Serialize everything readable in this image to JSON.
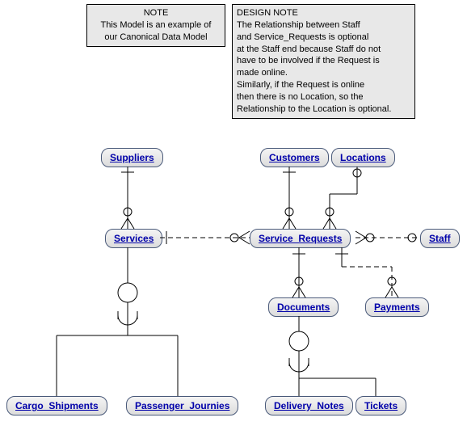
{
  "notes": {
    "note1": {
      "title": "NOTE",
      "line1": "This Model is an example of",
      "line2": "our Canonical Data Model"
    },
    "note2": {
      "title": "DESIGN NOTE",
      "l1": "The Relationship between Staff",
      "l2": "and Service_Requests is optional",
      "l3": "at the Staff end because Staff do not",
      "l4": "have to be involved if the Request is",
      "l5": "made online.",
      "l6": "Similarly, if the Request is online",
      "l7": "then there is no Location, so the",
      "l8": "Relationship to the Location is optional."
    }
  },
  "entities": {
    "suppliers": "Suppliers",
    "customers": "Customers",
    "locations": "Locations",
    "services": "Services",
    "service_requests": "Service_Requests",
    "staff": "Staff",
    "documents": "Documents",
    "payments": "Payments",
    "cargo_shipments": "Cargo_Shipments",
    "passenger_journies": "Passenger_Journies",
    "delivery_notes": "Delivery_Notes",
    "tickets": "Tickets"
  }
}
